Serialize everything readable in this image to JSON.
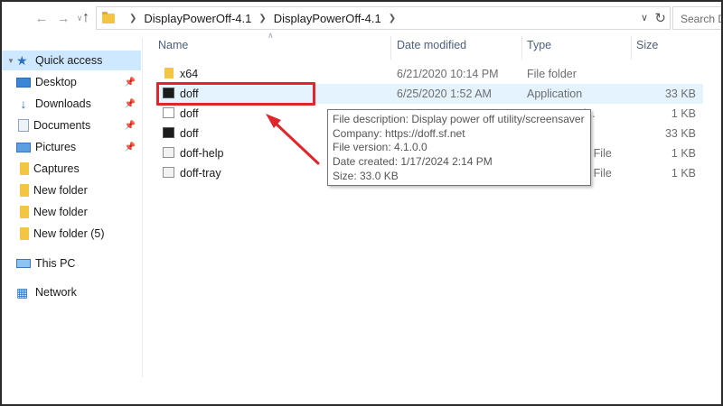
{
  "address_bar": {
    "breadcrumbs": [
      "DisplayPowerOff-4.1",
      "DisplayPowerOff-4.1"
    ],
    "search_placeholder": "Search D"
  },
  "nav_pane": {
    "items": [
      {
        "label": "Quick access",
        "icon": "star-icon",
        "selected": true,
        "pinned": false
      },
      {
        "label": "Desktop",
        "icon": "desktop-icon",
        "pinned": true
      },
      {
        "label": "Downloads",
        "icon": "download-icon",
        "pinned": true
      },
      {
        "label": "Documents",
        "icon": "documents-icon",
        "pinned": true
      },
      {
        "label": "Pictures",
        "icon": "pictures-icon",
        "pinned": true
      },
      {
        "label": "Captures",
        "icon": "folder-icon",
        "pinned": false
      },
      {
        "label": "New folder",
        "icon": "folder-icon",
        "pinned": false
      },
      {
        "label": "New folder",
        "icon": "folder-icon",
        "pinned": false
      },
      {
        "label": "New folder (5)",
        "icon": "folder-icon",
        "pinned": false
      },
      {
        "label": "This PC",
        "icon": "computer-icon",
        "pinned": false
      },
      {
        "label": "Network",
        "icon": "network-icon",
        "pinned": false
      }
    ]
  },
  "columns": {
    "name": "Name",
    "date_modified": "Date modified",
    "type": "Type",
    "size": "Size"
  },
  "files": [
    {
      "name": "x64",
      "date": "6/21/2020 10:14 PM",
      "type": "File folder",
      "size": "",
      "icon": "folder-icon"
    },
    {
      "name": "doff",
      "date": "6/25/2020 1:52 AM",
      "type": "Application",
      "size": "33 KB",
      "icon": "application-icon",
      "selected": true
    },
    {
      "name": "doff",
      "date": "",
      "type": "n setti...",
      "size": "1 KB",
      "icon": "settings-file-icon"
    },
    {
      "name": "doff",
      "date": "",
      "type": "",
      "size": "33 KB",
      "icon": "application-icon"
    },
    {
      "name": "doff-help",
      "date": "",
      "type": "ch File",
      "size": "1 KB",
      "icon": "batch-file-icon"
    },
    {
      "name": "doff-tray",
      "date": "",
      "type": "ch File",
      "size": "1 KB",
      "icon": "batch-file-icon"
    }
  ],
  "tooltip": {
    "line1": "File description: Display power off utility/screensaver",
    "line2": "Company: https://doff.sf.net",
    "line3": "File version: 4.1.0.0",
    "line4": "Date created: 1/17/2024 2:14 PM",
    "line5": "Size: 33.0 KB"
  },
  "colors": {
    "highlight_box": "#e0252b",
    "selection": "#e5f3ff",
    "nav_selected": "#cde8ff",
    "header_text": "#4d6082"
  }
}
